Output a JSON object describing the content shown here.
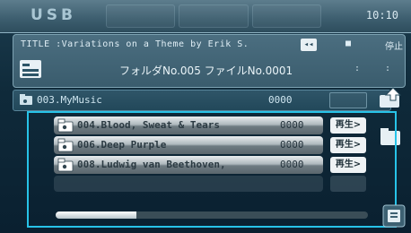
{
  "header": {
    "source": "USB",
    "clock": "10:10"
  },
  "now_playing": {
    "title_line": "TITLE :Variations on a Theme by Erik S.",
    "rewind_label": "◂◂",
    "stop_label": "■",
    "pause_label": "停止",
    "folder_file": "フォルダNo.005 ファイルNo.0001",
    "colon_a": ":",
    "colon_b": ":"
  },
  "current_folder": {
    "name": "003.MyMusic",
    "count": "0000"
  },
  "list": {
    "items": [
      {
        "name": "004.Blood, Sweat & Tears",
        "count": "0000",
        "play_label": "再生>"
      },
      {
        "name": "006.Deep Purple",
        "count": "0000",
        "play_label": "再生>"
      },
      {
        "name": "008.Ludwig van Beethoven,",
        "count": "0000",
        "play_label": "再生>"
      }
    ],
    "scroll_progress": 0.26
  },
  "colors": {
    "highlight_border": "#27c3e8",
    "title_bg": "#3a5c6d"
  }
}
